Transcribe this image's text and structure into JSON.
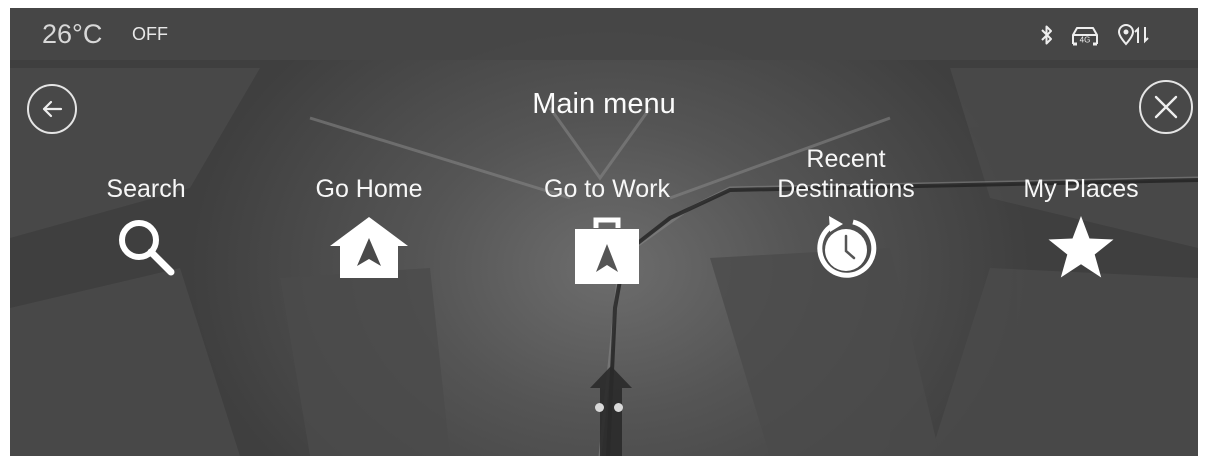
{
  "status": {
    "temperature": "26°C",
    "ac_state": "OFF",
    "icons": [
      "bluetooth-icon",
      "4g-car-icon",
      "location-sync-icon"
    ],
    "network_badge": "4G"
  },
  "header": {
    "title": "Main menu",
    "back_icon": "back-arrow-icon",
    "close_icon": "close-icon"
  },
  "menu": {
    "items": [
      {
        "label": "Search",
        "icon": "search-icon"
      },
      {
        "label": "Go Home",
        "icon": "home-icon"
      },
      {
        "label": "Go to Work",
        "icon": "work-briefcase-icon"
      },
      {
        "label": "Recent Destinations",
        "icon": "recent-history-icon"
      },
      {
        "label": "My Places",
        "icon": "star-icon"
      }
    ]
  },
  "pagination": {
    "pages": 2,
    "current": 1
  },
  "colors": {
    "status_bar": "#464646",
    "text": "#f7f7f7",
    "map_dark": "#3f3f3f",
    "map_light": "#6d6d6d"
  }
}
